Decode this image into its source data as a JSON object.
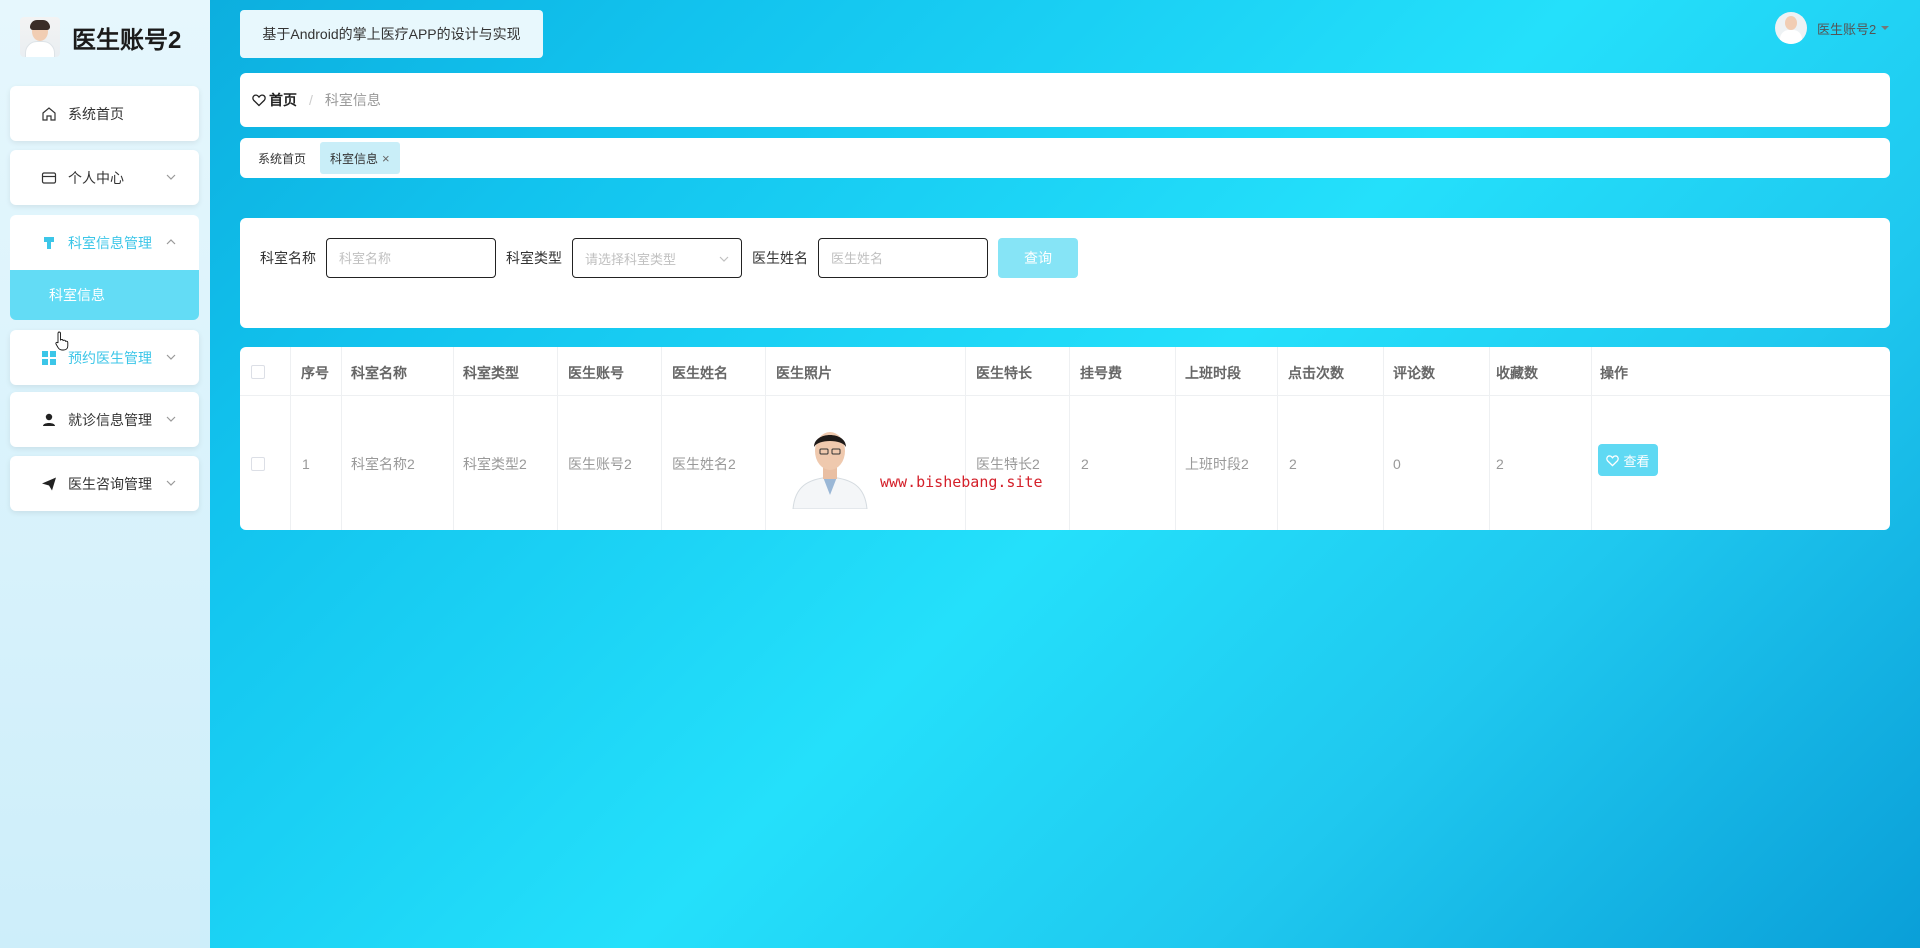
{
  "sidebar": {
    "brand_title": "医生账号2",
    "items": [
      {
        "label": "系统首页",
        "icon": "home-icon"
      },
      {
        "label": "个人中心",
        "icon": "card-icon"
      },
      {
        "label": "科室信息管理",
        "icon": "hospital-icon"
      },
      {
        "label": "预约医生管理",
        "icon": "grid-icon"
      },
      {
        "label": "就诊信息管理",
        "icon": "user-icon"
      },
      {
        "label": "医生咨询管理",
        "icon": "send-icon"
      }
    ],
    "sub_item": "科室信息"
  },
  "header": {
    "app_title": "基于Android的掌上医疗APP的设计与实现",
    "user_name": "医生账号2"
  },
  "breadcrumb": {
    "home": "首页",
    "separator": "/",
    "current": "科室信息"
  },
  "tabs": [
    {
      "label": "系统首页"
    },
    {
      "label": "科室信息",
      "close": "×"
    }
  ],
  "search": {
    "dept_name_label": "科室名称",
    "dept_name_placeholder": "科室名称",
    "dept_type_label": "科室类型",
    "dept_type_placeholder": "请选择科室类型",
    "doctor_name_label": "医生姓名",
    "doctor_name_placeholder": "医生姓名",
    "query_button": "查询"
  },
  "table": {
    "headers": [
      "序号",
      "科室名称",
      "科室类型",
      "医生账号",
      "医生姓名",
      "医生照片",
      "医生特长",
      "挂号费",
      "上班时段",
      "点击次数",
      "评论数",
      "收藏数",
      "操作"
    ],
    "rows": [
      {
        "index": "1",
        "dept_name": "科室名称2",
        "dept_type": "科室类型2",
        "doctor_account": "医生账号2",
        "doctor_name": "医生姓名2",
        "photo_watermark": "www.bishebang.site",
        "specialty": "医生特长2",
        "fee": "2",
        "shift": "上班时段2",
        "clicks": "2",
        "comments": "0",
        "favorites": "2",
        "action": "查看"
      }
    ]
  },
  "colors": {
    "accent": "#5fd9f3",
    "active_text": "#3cc6e8",
    "watermark": "#d4202a"
  }
}
